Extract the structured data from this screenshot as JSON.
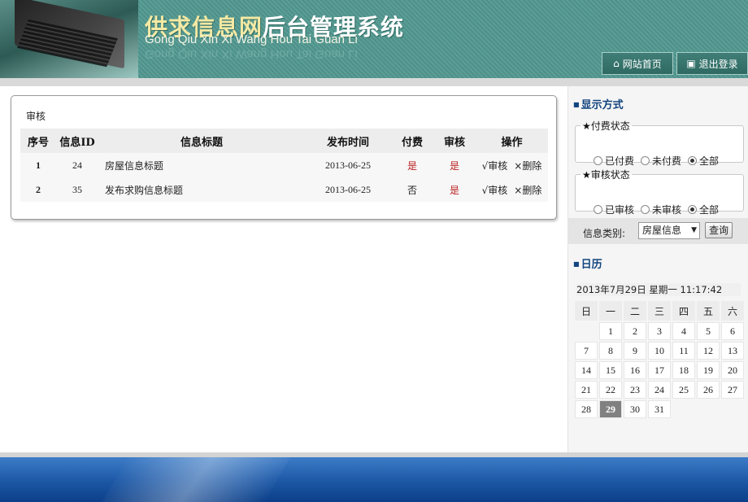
{
  "header": {
    "title_part1": "供求信息网",
    "title_part2": "后台管理系统",
    "subtitle": "Gong Qiu Xin Xi Wang Hou Tai Guan Li",
    "home_label": "网站首页",
    "logout_label": "退出登录"
  },
  "main": {
    "panel_title": "审核",
    "columns": [
      "序号",
      "信息ID",
      "信息标题",
      "发布时间",
      "付费",
      "审核",
      "操作"
    ],
    "rows": [
      {
        "no": "1",
        "id": "24",
        "title": "房屋信息标题",
        "date": "2013-06-25",
        "paid": "是",
        "audited": "是",
        "audit_action": "√审核",
        "delete_action": "×删除"
      },
      {
        "no": "2",
        "id": "35",
        "title": "发布求购信息标题",
        "date": "2013-06-25",
        "paid": "否",
        "audited": "是",
        "audit_action": "√审核",
        "delete_action": "×删除"
      }
    ]
  },
  "sidebar": {
    "display_head": "显示方式",
    "pay_group": {
      "legend": "★付费状态",
      "options": [
        "已付费",
        "未付费",
        "全部"
      ],
      "selected": "全部"
    },
    "audit_group": {
      "legend": "★审核状态",
      "options": [
        "已审核",
        "未审核",
        "全部"
      ],
      "selected": "全部"
    },
    "category_label": "信息类别:",
    "category_value": "房屋信息",
    "query_label": "查询",
    "calendar_head": "日历",
    "now_text": "2013年7月29日  星期一   11:17:42",
    "weekdays": [
      "日",
      "一",
      "二",
      "三",
      "四",
      "五",
      "六"
    ],
    "weeks": [
      [
        "",
        "1",
        "2",
        "3",
        "4",
        "5",
        "6"
      ],
      [
        "7",
        "8",
        "9",
        "10",
        "11",
        "12",
        "13"
      ],
      [
        "14",
        "15",
        "16",
        "17",
        "18",
        "19",
        "20"
      ],
      [
        "21",
        "22",
        "23",
        "24",
        "25",
        "26",
        "27"
      ],
      [
        "28",
        "29",
        "30",
        "31",
        "",
        "",
        ""
      ]
    ],
    "today": "29"
  },
  "colors": {
    "header_teal": "#4f918a",
    "heading_blue": "#12447e",
    "footer_blue": "#1e5aa8",
    "flag_red": "#b22"
  },
  "icons": {
    "home": "home-icon",
    "logout": "logout-icon"
  }
}
